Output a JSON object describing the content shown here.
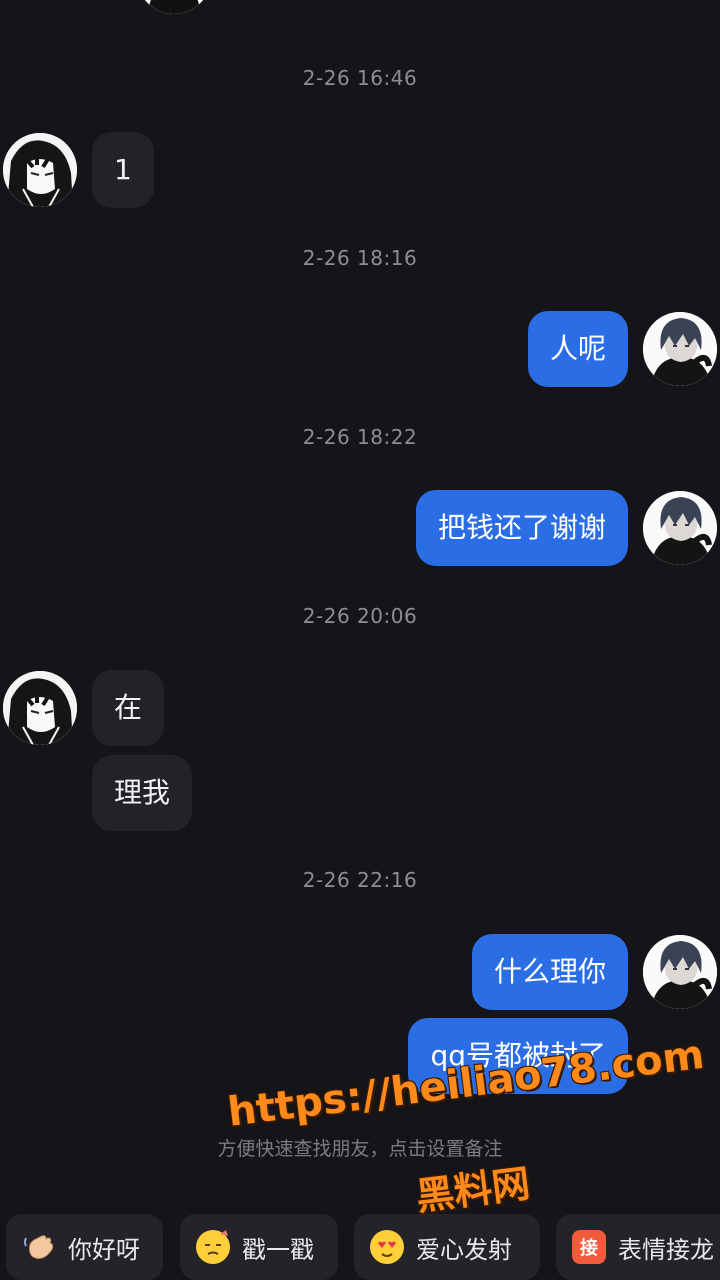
{
  "timestamps": [
    "2-26 16:46",
    "2-26 18:16",
    "2-26 18:22",
    "2-26 20:06",
    "2-26 22:16"
  ],
  "messages": {
    "in_1": "1",
    "out_1": "人呢",
    "out_2": "把钱还了谢谢",
    "in_2": "在",
    "in_3": "理我",
    "out_3": "什么理你",
    "out_4": "qq号都被封了"
  },
  "hint": "方便快速查找朋友，点击设置备注",
  "watermark": {
    "url": "https://heiliao78.com",
    "name": "黑料网"
  },
  "quick_replies": [
    {
      "label": "你好呀",
      "icon": "wave-hand-icon"
    },
    {
      "label": "戳一戳",
      "icon": "poke-face-icon"
    },
    {
      "label": "爱心发射",
      "icon": "heart-face-icon"
    },
    {
      "label": "表情接龙",
      "icon": "emoji-relay-icon",
      "badge": "接"
    }
  ],
  "colors": {
    "background": "#151519",
    "outgoing_bubble": "#2a6de4",
    "incoming_bubble": "#222228",
    "watermark": "#ff8a1c"
  }
}
